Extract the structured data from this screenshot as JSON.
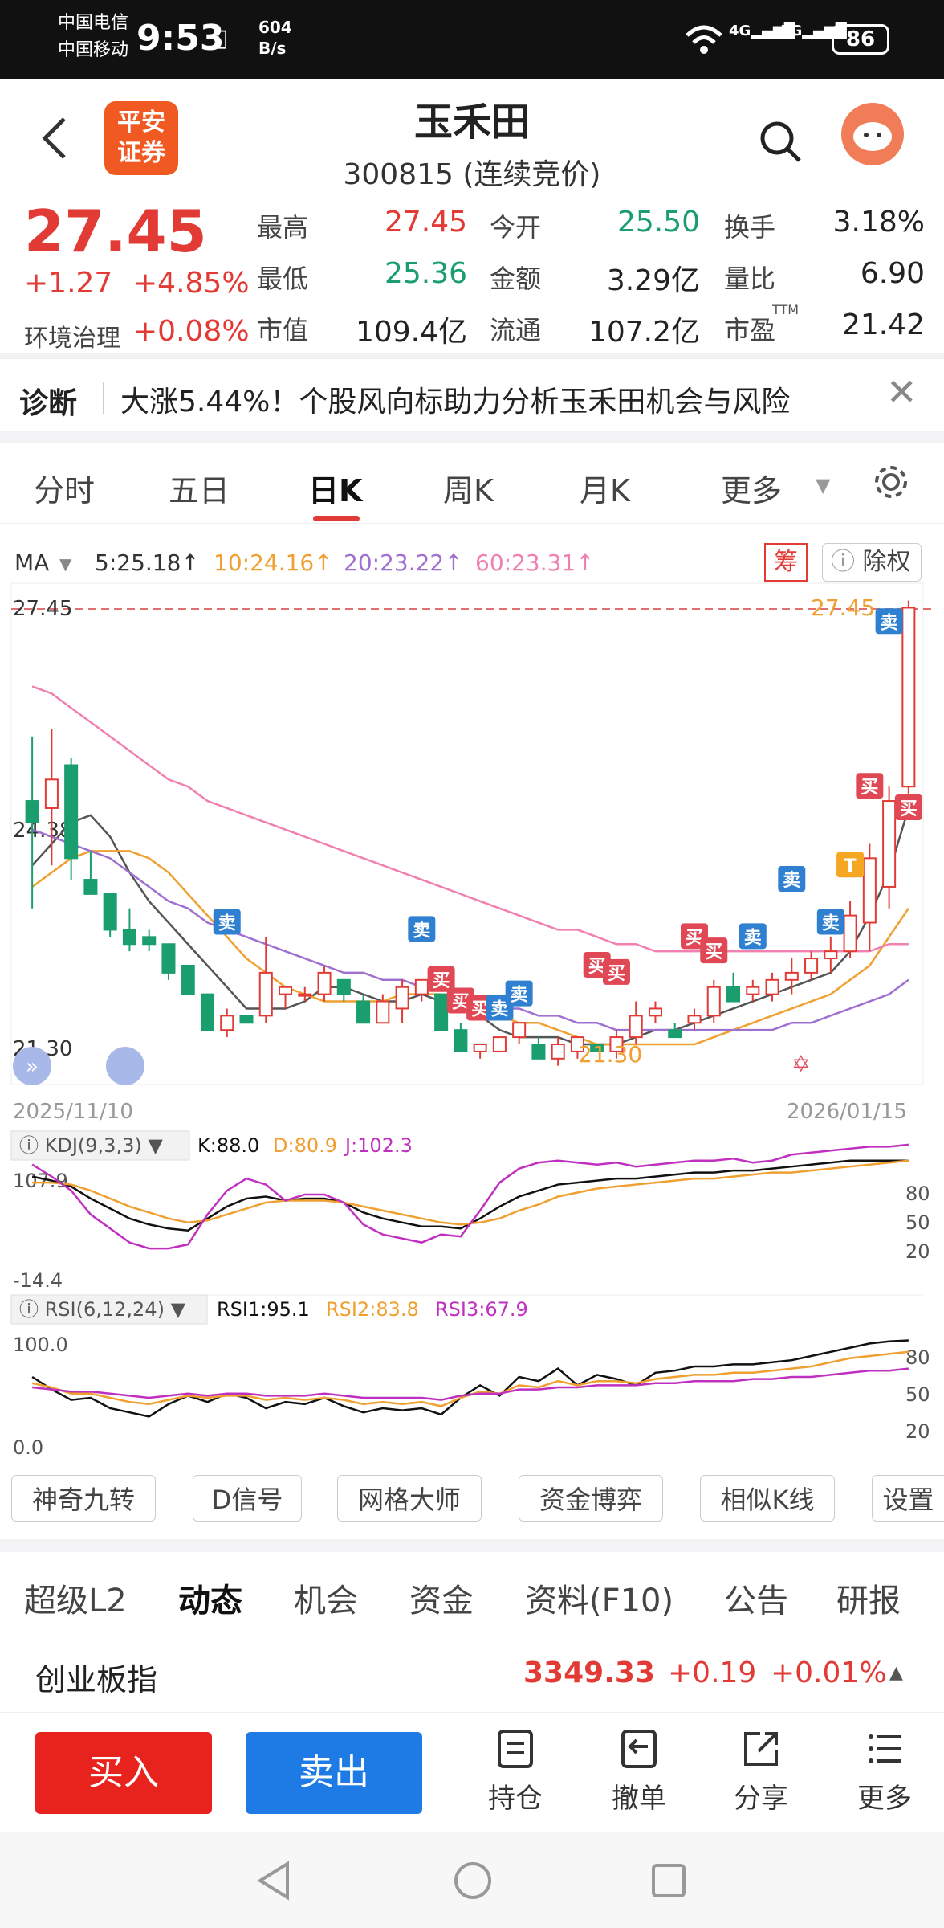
{
  "status": {
    "carrier1": "中国电信",
    "carrier2": "中国移动",
    "time": "9:53",
    "speed_value": "604",
    "speed_unit": "B/s",
    "battery": "86"
  },
  "header": {
    "logo_line1": "平安",
    "logo_line2": "证券",
    "title": "玉禾田",
    "code": "300815",
    "state": "(连续竞价)"
  },
  "quote": {
    "price": "27.45",
    "change": "+1.27",
    "change_pct": "+4.85%",
    "sector": "环境治理",
    "sector_pct": "+0.08%",
    "fields": [
      {
        "label": "最高",
        "value": "27.45",
        "color": "red"
      },
      {
        "label": "今开",
        "value": "25.50",
        "color": "green"
      },
      {
        "label": "换手",
        "value": "3.18%",
        "color": "black"
      },
      {
        "label": "最低",
        "value": "25.36",
        "color": "green"
      },
      {
        "label": "金额",
        "value": "3.29亿",
        "color": "black"
      },
      {
        "label": "量比",
        "value": "6.90",
        "color": "black"
      },
      {
        "label": "市值",
        "value": "109.4亿",
        "color": "black"
      },
      {
        "label": "流通",
        "value": "107.2亿",
        "color": "black"
      },
      {
        "label": "市盈",
        "value": "21.42",
        "color": "black"
      }
    ],
    "ttm": "TTM"
  },
  "diagnosis": {
    "label": "诊断",
    "text": "大涨5.44%！个股风向标助力分析玉禾田机会与风险"
  },
  "tabs": [
    "分时",
    "五日",
    "日K",
    "周K",
    "月K",
    "更多"
  ],
  "ma": {
    "label": "MA",
    "ma5": "5:25.18↑",
    "ma10": "10:24.16↑",
    "ma20": "20:23.22↑",
    "ma60": "60:23.31↑",
    "chip": "筹",
    "exright": "除权"
  },
  "chart_data": {
    "type": "candlestick",
    "y_high": "27.45",
    "y_mid": "24.38",
    "y_low": "21.30",
    "x_start": "2025/11/10",
    "x_end": "2026/01/15",
    "max_label": "27.45",
    "min_label": "21.30",
    "candles": [
      [
        24.7,
        25.6,
        23.2,
        24.4
      ],
      [
        24.6,
        25.7,
        23.8,
        25.0
      ],
      [
        25.2,
        25.3,
        23.6,
        23.9
      ],
      [
        23.6,
        24.0,
        23.4,
        23.4
      ],
      [
        23.4,
        23.4,
        22.8,
        22.9
      ],
      [
        22.9,
        23.2,
        22.6,
        22.7
      ],
      [
        22.8,
        22.9,
        22.6,
        22.7
      ],
      [
        22.7,
        22.7,
        22.2,
        22.3
      ],
      [
        22.4,
        22.4,
        22.0,
        22.0
      ],
      [
        22.0,
        22.0,
        21.5,
        21.5
      ],
      [
        21.5,
        21.8,
        21.4,
        21.7
      ],
      [
        21.7,
        21.7,
        21.6,
        21.6
      ],
      [
        21.7,
        22.8,
        21.6,
        22.3
      ],
      [
        22.0,
        22.1,
        21.8,
        22.1
      ],
      [
        22.0,
        22.1,
        21.9,
        22.0
      ],
      [
        22.0,
        22.4,
        21.9,
        22.3
      ],
      [
        22.2,
        22.2,
        21.9,
        22.0
      ],
      [
        21.9,
        22.0,
        21.6,
        21.6
      ],
      [
        21.6,
        22.0,
        21.6,
        21.9
      ],
      [
        21.8,
        22.2,
        21.6,
        22.1
      ],
      [
        22.0,
        22.2,
        21.9,
        22.2
      ],
      [
        22.0,
        22.0,
        21.5,
        21.5
      ],
      [
        21.5,
        21.6,
        21.2,
        21.2
      ],
      [
        21.2,
        21.3,
        21.1,
        21.3
      ],
      [
        21.2,
        21.4,
        21.2,
        21.4
      ],
      [
        21.4,
        21.6,
        21.3,
        21.6
      ],
      [
        21.3,
        21.4,
        21.1,
        21.1
      ],
      [
        21.1,
        21.4,
        21.0,
        21.3
      ],
      [
        21.2,
        21.4,
        21.1,
        21.4
      ],
      [
        21.3,
        21.3,
        21.2,
        21.2
      ],
      [
        21.2,
        21.5,
        21.1,
        21.4
      ],
      [
        21.4,
        21.9,
        21.3,
        21.7
      ],
      [
        21.7,
        21.9,
        21.6,
        21.8
      ],
      [
        21.5,
        21.6,
        21.4,
        21.4
      ],
      [
        21.6,
        21.8,
        21.5,
        21.7
      ],
      [
        21.7,
        22.2,
        21.6,
        22.1
      ],
      [
        22.1,
        22.3,
        21.9,
        21.9
      ],
      [
        22.0,
        22.2,
        21.9,
        22.1
      ],
      [
        22.0,
        22.3,
        21.9,
        22.2
      ],
      [
        22.2,
        22.5,
        22.0,
        22.3
      ],
      [
        22.3,
        22.6,
        22.2,
        22.5
      ],
      [
        22.5,
        22.8,
        22.3,
        22.6
      ],
      [
        22.6,
        23.3,
        22.5,
        23.1
      ],
      [
        23.0,
        24.1,
        22.6,
        23.9
      ],
      [
        23.5,
        24.9,
        23.2,
        24.7
      ],
      [
        24.9,
        27.5,
        24.5,
        27.4
      ]
    ],
    "ma_series": [
      {
        "name": "MA5",
        "color": "#555555",
        "values": [
          23.8,
          24.1,
          24.4,
          24.5,
          24.2,
          23.7,
          23.3,
          23.0,
          22.7,
          22.4,
          22.1,
          21.8,
          21.8,
          21.8,
          21.9,
          22.1,
          22.1,
          22.0,
          21.9,
          21.9,
          22.0,
          21.9,
          21.8,
          21.7,
          21.5,
          21.4,
          21.4,
          21.4,
          21.3,
          21.3,
          21.3,
          21.4,
          21.5,
          21.5,
          21.6,
          21.7,
          21.8,
          21.9,
          22.0,
          22.1,
          22.2,
          22.3,
          22.6,
          23.1,
          23.7,
          24.6
        ]
      },
      {
        "name": "MA10",
        "color": "#f0a030",
        "values": [
          23.5,
          23.7,
          23.9,
          24.0,
          24.0,
          24.0,
          23.9,
          23.7,
          23.4,
          23.1,
          22.8,
          22.5,
          22.3,
          22.1,
          22.0,
          21.9,
          21.9,
          21.9,
          21.9,
          22.0,
          22.0,
          22.0,
          21.9,
          21.8,
          21.7,
          21.6,
          21.6,
          21.5,
          21.4,
          21.3,
          21.3,
          21.3,
          21.3,
          21.3,
          21.3,
          21.4,
          21.5,
          21.6,
          21.7,
          21.8,
          21.9,
          22.0,
          22.2,
          22.4,
          22.8,
          23.2
        ]
      },
      {
        "name": "MA20",
        "color": "#a070d0",
        "values": [
          24.3,
          24.2,
          24.1,
          24.0,
          23.9,
          23.7,
          23.5,
          23.3,
          23.2,
          23.0,
          22.9,
          22.8,
          22.7,
          22.6,
          22.5,
          22.4,
          22.3,
          22.3,
          22.2,
          22.2,
          22.1,
          22.1,
          22.0,
          21.9,
          21.8,
          21.8,
          21.7,
          21.7,
          21.6,
          21.6,
          21.5,
          21.5,
          21.5,
          21.5,
          21.5,
          21.5,
          21.5,
          21.5,
          21.5,
          21.6,
          21.6,
          21.7,
          21.8,
          21.9,
          22.0,
          22.2
        ]
      },
      {
        "name": "MA60",
        "color": "#f080b0",
        "values": [
          26.3,
          26.2,
          26.0,
          25.8,
          25.6,
          25.4,
          25.2,
          25.0,
          24.9,
          24.7,
          24.6,
          24.5,
          24.4,
          24.3,
          24.2,
          24.1,
          24.0,
          23.9,
          23.8,
          23.7,
          23.6,
          23.5,
          23.4,
          23.3,
          23.2,
          23.1,
          23.0,
          22.9,
          22.9,
          22.8,
          22.7,
          22.7,
          22.6,
          22.6,
          22.6,
          22.6,
          22.6,
          22.6,
          22.6,
          22.6,
          22.6,
          22.6,
          22.6,
          22.6,
          22.7,
          22.7
        ]
      }
    ],
    "signals": [
      {
        "i": 10,
        "t": "卖",
        "c": "blue",
        "p": 23.0
      },
      {
        "i": 20,
        "t": "卖",
        "c": "blue",
        "p": 22.9
      },
      {
        "i": 21,
        "t": "买",
        "c": "red",
        "p": 22.2
      },
      {
        "i": 22,
        "t": "买",
        "c": "red",
        "p": 21.9
      },
      {
        "i": 23,
        "t": "买",
        "c": "red",
        "p": 21.8
      },
      {
        "i": 24,
        "t": "卖",
        "c": "blue",
        "p": 21.8
      },
      {
        "i": 25,
        "t": "卖",
        "c": "blue",
        "p": 22.0
      },
      {
        "i": 29,
        "t": "买",
        "c": "red",
        "p": 22.4
      },
      {
        "i": 30,
        "t": "买",
        "c": "red",
        "p": 22.3
      },
      {
        "i": 34,
        "t": "买",
        "c": "red",
        "p": 22.8
      },
      {
        "i": 35,
        "t": "买",
        "c": "red",
        "p": 22.6
      },
      {
        "i": 37,
        "t": "卖",
        "c": "blue",
        "p": 22.8
      },
      {
        "i": 39,
        "t": "卖",
        "c": "blue",
        "p": 23.6
      },
      {
        "i": 41,
        "t": "卖",
        "c": "blue",
        "p": 23.0
      },
      {
        "i": 42,
        "t": "T",
        "c": "orange",
        "p": 23.8
      },
      {
        "i": 43,
        "t": "买",
        "c": "red",
        "p": 24.9
      },
      {
        "i": 44,
        "t": "卖",
        "c": "blue",
        "p": 27.2
      },
      {
        "i": 45,
        "t": "买",
        "c": "red",
        "p": 24.6
      }
    ],
    "kdj": {
      "label": "KDJ(9,3,3)",
      "k": "K:88.0",
      "d": "D:80.9",
      "j": "J:102.3",
      "top": "107.9",
      "bottom": "-14.4",
      "ticks": [
        "80",
        "50",
        "20"
      ],
      "K": [
        72,
        68,
        62,
        50,
        40,
        30,
        24,
        20,
        18,
        30,
        42,
        50,
        52,
        48,
        50,
        50,
        46,
        36,
        30,
        26,
        22,
        22,
        20,
        30,
        42,
        52,
        58,
        64,
        66,
        68,
        70,
        70,
        72,
        74,
        76,
        76,
        78,
        78,
        80,
        82,
        84,
        86,
        88,
        88,
        88,
        88
      ],
      "D": [
        66,
        66,
        64,
        58,
        50,
        42,
        36,
        30,
        26,
        28,
        34,
        40,
        46,
        48,
        48,
        48,
        46,
        42,
        38,
        34,
        30,
        26,
        24,
        26,
        30,
        38,
        44,
        52,
        56,
        60,
        62,
        64,
        66,
        68,
        70,
        70,
        72,
        74,
        76,
        76,
        78,
        80,
        82,
        84,
        86,
        88
      ],
      "J": [
        84,
        72,
        58,
        34,
        20,
        6,
        0,
        0,
        4,
        34,
        58,
        70,
        64,
        48,
        54,
        54,
        46,
        24,
        14,
        10,
        6,
        14,
        12,
        38,
        66,
        80,
        86,
        88,
        86,
        84,
        86,
        82,
        84,
        86,
        88,
        88,
        90,
        86,
        88,
        94,
        96,
        98,
        100,
        102,
        102,
        104
      ]
    },
    "rsi": {
      "label": "RSI(6,12,24)",
      "r1": "RSI1:95.1",
      "r2": "RSI2:83.8",
      "r3": "RSI3:67.9",
      "top": "100.0",
      "bottom": "0.0",
      "ticks": [
        "80",
        "50",
        "20"
      ],
      "R1": [
        60,
        48,
        38,
        40,
        30,
        26,
        22,
        34,
        42,
        36,
        44,
        40,
        30,
        36,
        34,
        40,
        32,
        26,
        30,
        28,
        30,
        24,
        40,
        52,
        42,
        60,
        56,
        68,
        52,
        62,
        58,
        52,
        64,
        66,
        70,
        70,
        72,
        72,
        74,
        76,
        80,
        84,
        88,
        92,
        94,
        95
      ],
      "R2": [
        54,
        50,
        44,
        44,
        40,
        36,
        34,
        38,
        42,
        40,
        42,
        42,
        38,
        40,
        38,
        40,
        38,
        34,
        36,
        34,
        36,
        32,
        40,
        46,
        44,
        52,
        50,
        56,
        52,
        56,
        56,
        54,
        58,
        60,
        62,
        62,
        64,
        64,
        66,
        68,
        70,
        74,
        78,
        80,
        82,
        84
      ],
      "R3": [
        50,
        48,
        46,
        46,
        44,
        42,
        40,
        42,
        44,
        42,
        44,
        44,
        42,
        42,
        42,
        44,
        42,
        40,
        40,
        40,
        40,
        38,
        42,
        44,
        44,
        48,
        48,
        50,
        50,
        52,
        52,
        52,
        54,
        54,
        56,
        56,
        56,
        58,
        58,
        60,
        60,
        62,
        64,
        66,
        66,
        68
      ]
    }
  },
  "tools": [
    "神奇九转",
    "D信号",
    "网格大师",
    "资金博弈",
    "相似K线",
    "设置"
  ],
  "bottom_tabs": [
    "超级L2",
    "动态",
    "机会",
    "资金",
    "资料(F10)",
    "公告",
    "研报"
  ],
  "index": {
    "name": "创业板指",
    "value": "3349.33",
    "change": "+0.19",
    "pct": "+0.01%"
  },
  "actions": {
    "buy": "买入",
    "sell": "卖出",
    "items": [
      "持仓",
      "撤单",
      "分享",
      "更多"
    ]
  },
  "colors": {
    "up": "#e23b36",
    "down": "#1a9e6e",
    "buy_btn": "#e8231e",
    "sell_btn": "#1e7be6"
  }
}
